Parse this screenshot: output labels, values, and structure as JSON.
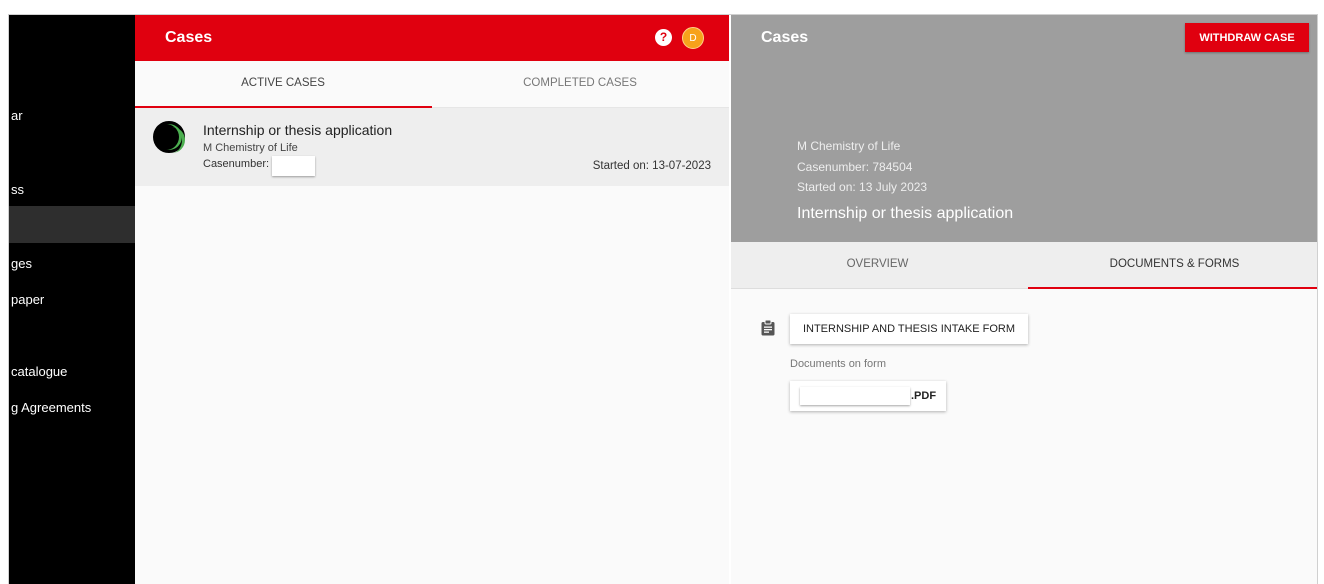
{
  "sidebar": {
    "items": [
      {
        "label": "ar"
      },
      {
        "label": "ss"
      },
      {
        "label": ""
      },
      {
        "label": "ges"
      },
      {
        "label": "paper"
      },
      {
        "label": "catalogue"
      },
      {
        "label": "g Agreements"
      }
    ]
  },
  "cases_panel": {
    "title": "Cases",
    "help_icon": "?",
    "avatar_initial": "D",
    "tabs": [
      {
        "label": "ACTIVE CASES"
      },
      {
        "label": "COMPLETED CASES"
      }
    ],
    "case": {
      "title": "Internship or thesis application",
      "program": "M Chemistry of Life",
      "casenumber_label": "Casenumber:",
      "started": "Started on: 13-07-2023"
    }
  },
  "detail": {
    "title": "Cases",
    "withdraw_label": "WITHDRAW CASE",
    "program": "M Chemistry of Life",
    "casenumber": "Casenumber: 784504",
    "started": "Started on: 13 July 2023",
    "name": "Internship or thesis application",
    "tabs": [
      {
        "label": "OVERVIEW"
      },
      {
        "label": "DOCUMENTS & FORMS"
      }
    ],
    "form_label": "INTERNSHIP AND THESIS INTAKE FORM",
    "docs_label": "Documents on form",
    "file_ext": ".PDF"
  },
  "colors": {
    "brand_red": "#e0000f",
    "avatar_orange": "#f7a21b",
    "header_grey": "#9e9e9e",
    "progress_green": "#4caf50"
  },
  "icons": {
    "help": "help-icon",
    "clipboard": "clipboard-icon",
    "progress": "progress-ring-icon"
  }
}
